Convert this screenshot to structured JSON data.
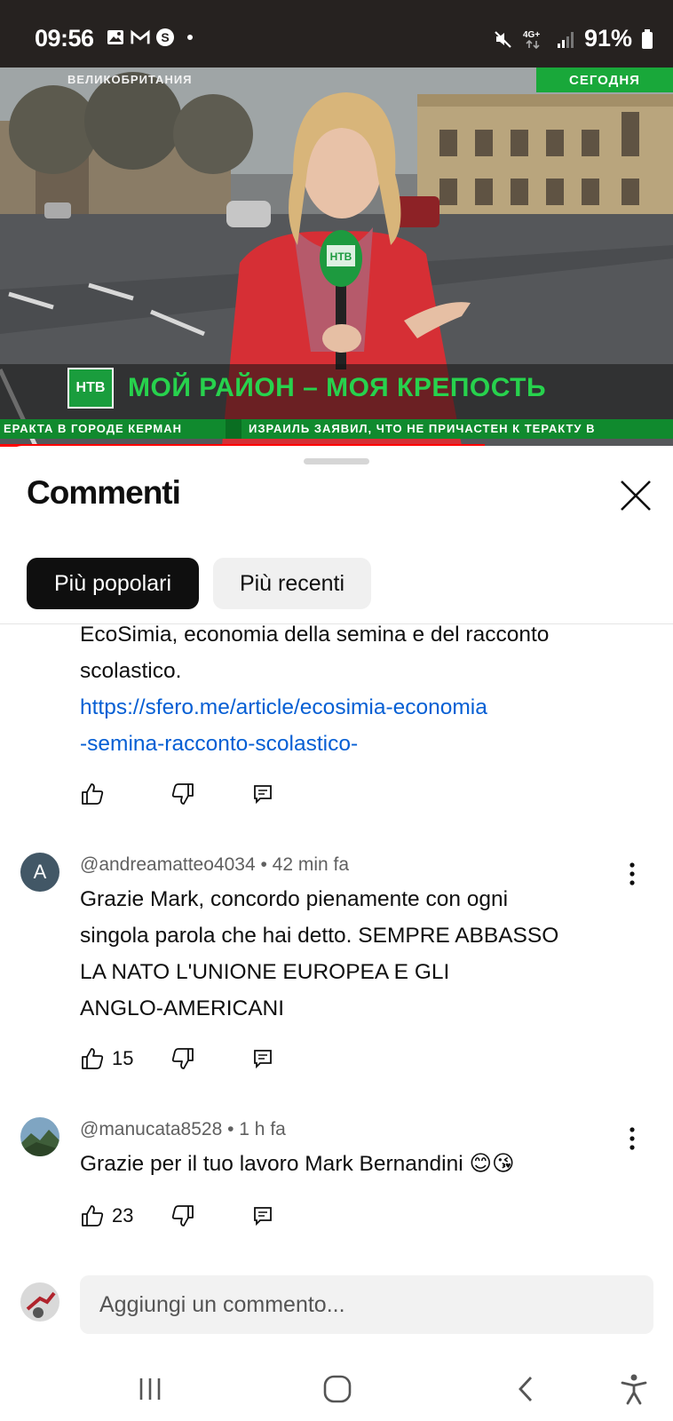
{
  "status_bar": {
    "time": "09:56",
    "battery": "91%",
    "network": "4G+",
    "icons": [
      "gallery-icon",
      "gmail-icon",
      "skype-icon",
      "dot-icon",
      "mute-icon",
      "signal-icon",
      "battery-icon"
    ]
  },
  "video": {
    "country_caption": "ВЕЛИКОБРИТАНИЯ",
    "today_badge": "СЕГОДНЯ",
    "channel_logo": "НТВ",
    "headline": "МОЙ РАЙОН – МОЯ КРЕПОСТЬ",
    "ticker_left": "ЕРАКТА В ГОРОДЕ КЕРМАН",
    "ticker_right": "ИЗРАИЛЬ ЗАЯВИЛ, ЧТО НЕ ПРИЧАСТЕН К ТЕРАКТУ В",
    "progress_fraction": 0.72
  },
  "comments_panel": {
    "title": "Commenti",
    "filters": [
      {
        "label": "Più popolari",
        "selected": true
      },
      {
        "label": "Più recenti",
        "selected": false
      }
    ]
  },
  "comments": [
    {
      "text_line1": "EcoSimia, economia della semina e del racconto",
      "text_line2": "scolastico.",
      "link_line1": "https://sfero.me/article/ecosimia-economia",
      "link_line2": "-semina-racconto-scolastico-",
      "likes": ""
    },
    {
      "avatar_letter": "A",
      "author": "@andreamatteo4034",
      "time": "42 min fa",
      "lines": [
        "Grazie Mark, concordo pienamente con ogni",
        "singola parola che hai detto. SEMPRE ABBASSO",
        "LA NATO L'UNIONE EUROPEA E GLI",
        "ANGLO-AMERICANI"
      ],
      "likes": "15"
    },
    {
      "author": "@manucata8528",
      "time": "1 h fa",
      "text": "Grazie per il tuo lavoro Mark Bernandini 😊😘",
      "likes": "23"
    }
  ],
  "add_comment": {
    "placeholder": "Aggiungi un commento..."
  },
  "colors": {
    "link": "#065fd4",
    "chip_active": "#0f0f0f",
    "chip_inactive": "#f0f0f0",
    "ntv_green": "#27d24d",
    "progress": "#ff0000"
  }
}
